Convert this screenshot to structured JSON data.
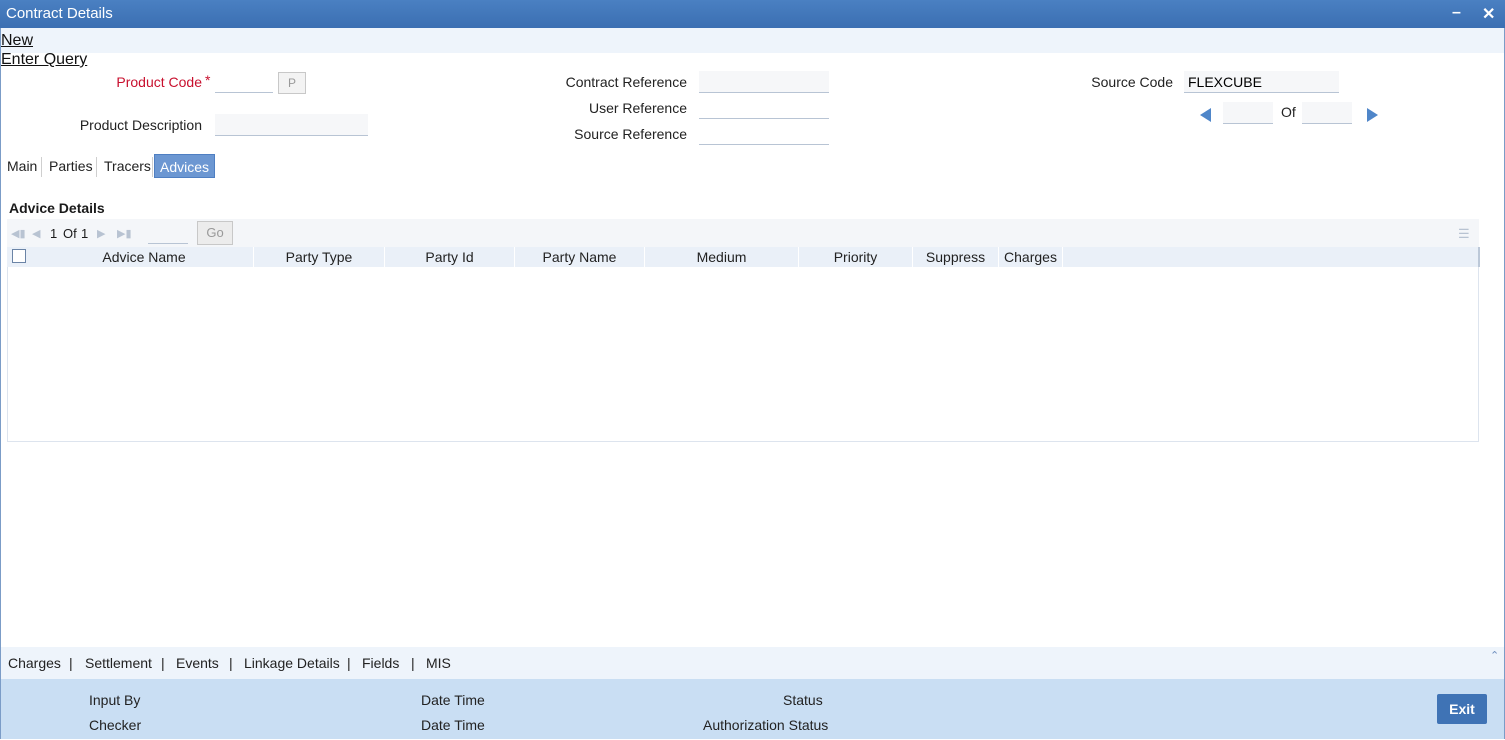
{
  "window": {
    "title": "Contract Details",
    "minimize_label": "–",
    "close_label": "✕"
  },
  "menu": {
    "new": "New",
    "enter_query": "Enter Query"
  },
  "header": {
    "product_code_label": "Product Code",
    "required_marker": "*",
    "product_code_value": "",
    "lov_button": "P",
    "product_description_label": "Product Description",
    "contract_reference_label": "Contract Reference",
    "user_reference_label": "User Reference",
    "source_reference_label": "Source Reference",
    "source_code_label": "Source Code",
    "source_code_value": "FLEXCUBE",
    "of_label": "Of"
  },
  "tabs": [
    {
      "label": "Main",
      "active": false
    },
    {
      "label": "Parties",
      "active": false
    },
    {
      "label": "Tracers",
      "active": false
    },
    {
      "label": "Advices",
      "active": true
    }
  ],
  "advice_details": {
    "title": "Advice Details",
    "pager": {
      "current": "1",
      "of": "Of",
      "total": "1",
      "go": "Go"
    },
    "columns": [
      "Advice Name",
      "Party Type",
      "Party Id",
      "Party Name",
      "Medium",
      "Priority",
      "Suppress",
      "Charges"
    ],
    "rows": []
  },
  "footer": {
    "links": [
      "Charges",
      "Settlement",
      "Events",
      "Linkage Details",
      "Fields",
      "MIS"
    ],
    "separator": "|",
    "input_by": "Input By",
    "checker": "Checker",
    "date_time_1": "Date Time",
    "date_time_2": "Date Time",
    "status": "Status",
    "authorization_status": "Authorization Status",
    "exit": "Exit"
  },
  "colors": {
    "title_bar": "#3b6fb2",
    "active_tab": "#6c97d2",
    "audit_panel": "#c9def3",
    "required": "#c8102e",
    "exit_button": "#3f73b5"
  }
}
